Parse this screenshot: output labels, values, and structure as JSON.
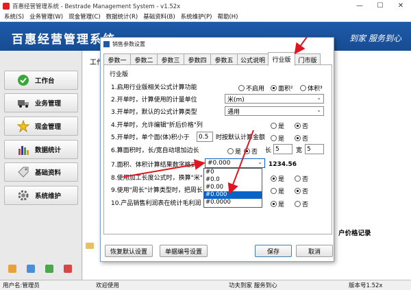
{
  "window": {
    "title": "百惠经营管理系统 - Bestrade Management System - v1.52x",
    "min": "—",
    "max": "☐",
    "close": "✕"
  },
  "menu": [
    "系统(S)",
    "业务管理(W)",
    "现金管理(C)",
    "数据统计(R)",
    "基础资料(B)",
    "系统维护(P)",
    "帮助(H)"
  ],
  "banner": {
    "title": "百惠经营管理系统",
    "slogan": "到家  服务到心"
  },
  "sidebar": [
    {
      "label": "工作台",
      "icon": "check-icon"
    },
    {
      "label": "业务管理",
      "icon": "truck-icon"
    },
    {
      "label": "现金管理",
      "icon": "star-icon"
    },
    {
      "label": "数据统计",
      "icon": "bar-chart-icon"
    },
    {
      "label": "基础资料",
      "icon": "tag-icon"
    },
    {
      "label": "系统维护",
      "icon": "gear-icon"
    }
  ],
  "main": {
    "workbench_label": "工作",
    "price_record": "户价格记录"
  },
  "status": {
    "user": "用户名:管理员",
    "welcome": "欢迎使用",
    "slogan": "功夫到家  服务到心",
    "version": "版本号1.52x"
  },
  "dialog": {
    "title": "销售参数设置",
    "tabs": [
      "参数一",
      "参数二",
      "参数三",
      "参数四",
      "参数五",
      "公式说明",
      "行业版",
      "门市版"
    ],
    "active_tab": "行业版",
    "group_label": "行业版",
    "rows": [
      {
        "label": "1.启用行业版相关公式计算功能",
        "options": [
          "不启用",
          "面积²",
          "体积³"
        ],
        "selected": "面积²"
      },
      {
        "label": "2.开单时，计算使用的计量单位",
        "select_value": "米(m)"
      },
      {
        "label": "3.开单时，默认的公式计算类型",
        "select_value": "通用"
      },
      {
        "label": "4.开单时，允许编辑\"折后价格\"列",
        "options": [
          "是",
          "否"
        ],
        "selected": "否"
      },
      {
        "label": "5.开单时，单个面(体)积小于",
        "input_value": "0.5",
        "suffix": "时按默认计算金额",
        "options": [
          "是",
          "否"
        ],
        "selected": "否"
      },
      {
        "label": "6.算面积时，长/宽自动增加边长",
        "options": [
          "是",
          "否"
        ],
        "selected": "否",
        "len_label": "长",
        "len_value": "5",
        "wid_label": "宽",
        "wid_value": "5"
      },
      {
        "label": "7.面积、体积计算结果数字格式",
        "select_value": "#0.000",
        "preview": "1234.56"
      },
      {
        "label": "8.使用加工长度公式时，换算\"米\"",
        "options": [
          "是",
          "否"
        ],
        "selected": "是"
      },
      {
        "label": "9.使用\"周长\"计算类型时，把周长",
        "options": [
          "是",
          "否"
        ],
        "selected": "否"
      },
      {
        "label": "10.产品销售利润表在统计毛利润",
        "options": [
          "是",
          "否"
        ],
        "selected": "是"
      }
    ],
    "format_options": [
      "#0",
      "#0.0",
      "#0.00",
      "#0.000",
      "#0.0000"
    ],
    "format_selected": "#0.000",
    "buttons": {
      "reset": "恢复默认设置",
      "numbering": "单据编号设置",
      "save": "保存",
      "cancel": "取消"
    }
  },
  "colors": {
    "banner": "#1e5aa8",
    "highlight": "#0a64c8",
    "annotation": "#e0151f"
  }
}
